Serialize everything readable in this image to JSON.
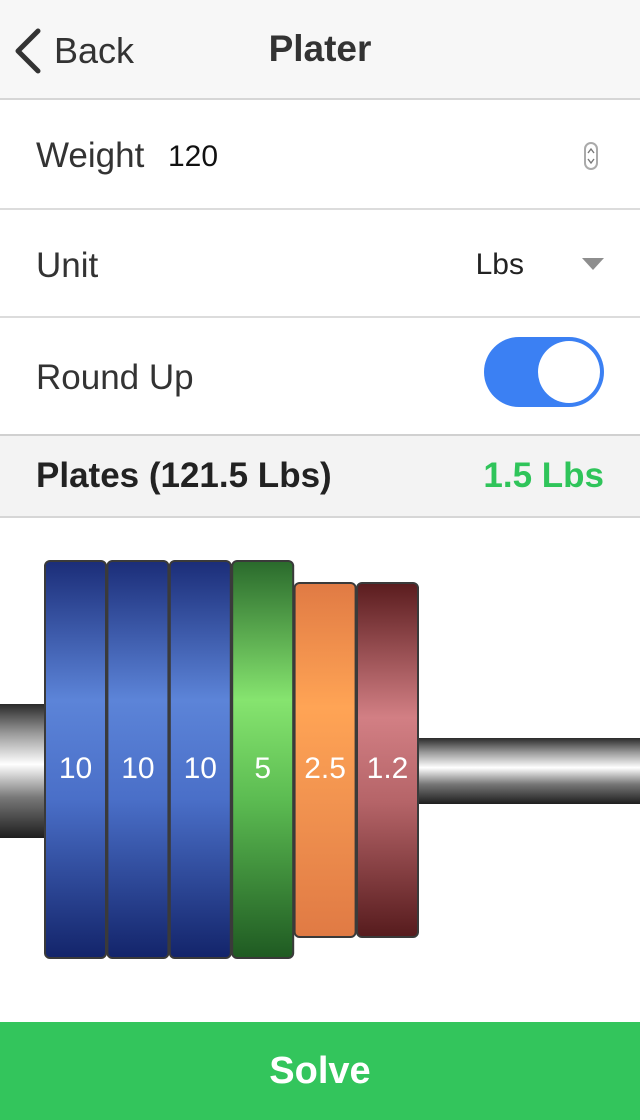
{
  "nav": {
    "back_label": "Back",
    "title": "Plater"
  },
  "weight": {
    "label": "Weight",
    "value": "120"
  },
  "unit": {
    "label": "Unit",
    "value": "Lbs",
    "icon": "caret-down-icon"
  },
  "round_up": {
    "label": "Round Up",
    "on": true,
    "color": "#3b80f3"
  },
  "plates": {
    "title": "Plates (121.5 Lbs)",
    "diff": "1.5 Lbs",
    "diff_color": "#2fc45a"
  },
  "plate_stack": [
    {
      "label": "10",
      "color": "blue",
      "size": "large"
    },
    {
      "label": "10",
      "color": "blue",
      "size": "large"
    },
    {
      "label": "10",
      "color": "blue",
      "size": "large"
    },
    {
      "label": "5",
      "color": "green",
      "size": "large"
    },
    {
      "label": "2.5",
      "color": "orange",
      "size": "small"
    },
    {
      "label": "1.2",
      "color": "maroon",
      "size": "small"
    }
  ],
  "solve": {
    "label": "Solve",
    "color": "#33c55c"
  }
}
